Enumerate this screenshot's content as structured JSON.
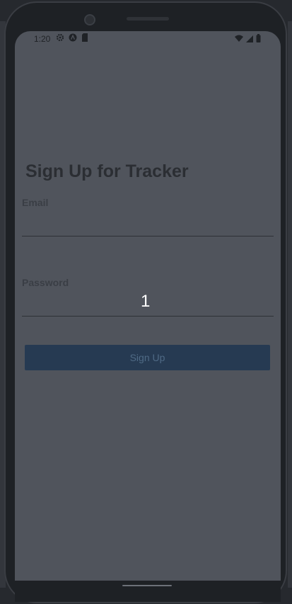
{
  "status_bar": {
    "time": "1:20",
    "left_icons": [
      "gear-icon",
      "accessibility-icon",
      "sd-card-icon"
    ],
    "right_icons": [
      "wifi-icon",
      "signal-icon",
      "battery-icon"
    ]
  },
  "page": {
    "title": "Sign Up for Tracker"
  },
  "form": {
    "email": {
      "label": "Email",
      "value": ""
    },
    "password": {
      "label": "Password",
      "value": ""
    },
    "submit_label": "Sign Up"
  },
  "overlay": {
    "number": "1"
  },
  "colors": {
    "screen_bg": "#50545c",
    "button_bg": "#263a52",
    "button_text": "#4f6a85",
    "title_text": "#2b2e33"
  }
}
